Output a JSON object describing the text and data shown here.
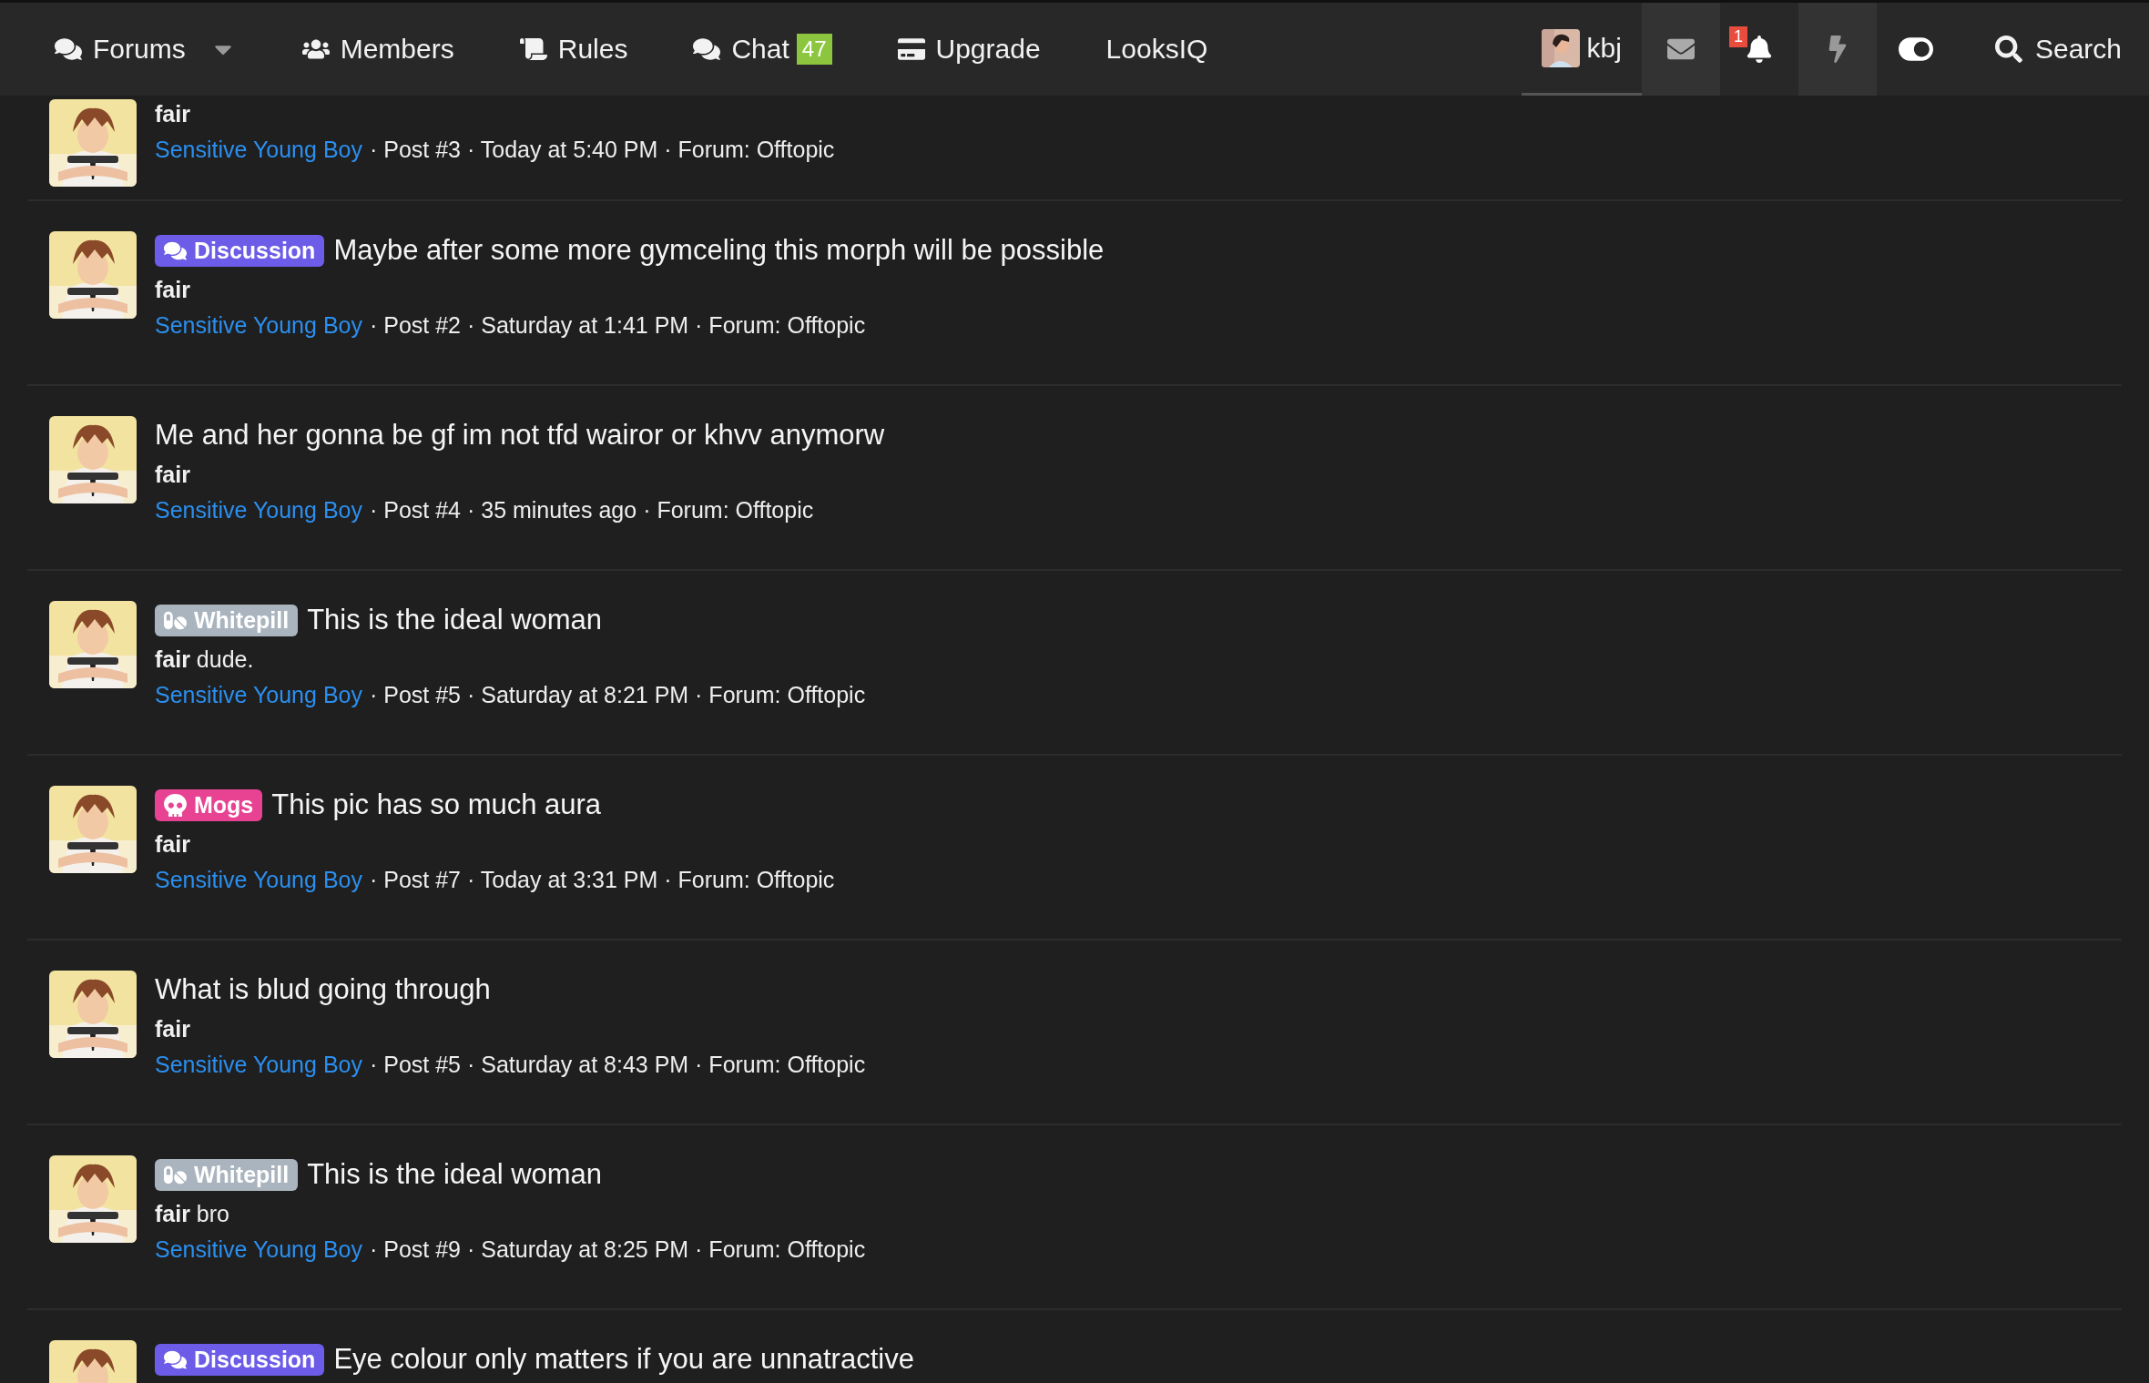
{
  "nav": {
    "items": [
      {
        "label": "Forums"
      },
      {
        "label": "Members"
      },
      {
        "label": "Rules"
      },
      {
        "label": "Chat",
        "badge": "47"
      },
      {
        "label": "Upgrade"
      },
      {
        "label": "LooksIQ"
      }
    ],
    "user": {
      "name": "kbj",
      "selected": true
    },
    "notification_count": "1",
    "search": {
      "label": "Search"
    }
  },
  "posts": [
    {
      "body": "fair",
      "body_bold": true,
      "author": "Sensitive Young Boy",
      "meta": "· Post #3 · Today at 5:40 PM · Forum: Offtopic"
    },
    {
      "prefix": {
        "label": "Discussion",
        "kind": "discussion",
        "color": "#6c5ce7"
      },
      "title": "Maybe after some more gymceling this morph will be possible",
      "body": "fair",
      "body_bold": true,
      "author": "Sensitive Young Boy",
      "meta": "· Post #2 · Saturday at 1:41 PM · Forum: Offtopic"
    },
    {
      "title": "Me and her gonna be gf im not tfd wairor or khvv anymorw",
      "body": "fair",
      "body_bold": true,
      "author": "Sensitive Young Boy",
      "meta": "· Post #4 · 35 minutes ago · Forum: Offtopic"
    },
    {
      "prefix": {
        "label": "Whitepill",
        "kind": "whitepill",
        "color": "#aab4be"
      },
      "title": "This is the ideal woman",
      "body": "**fair** dude.",
      "body_bold": false,
      "author": "Sensitive Young Boy",
      "meta": "· Post #5 · Saturday at 8:21 PM · Forum: Offtopic"
    },
    {
      "prefix": {
        "label": "Mogs",
        "kind": "mogs",
        "color": "#e84393"
      },
      "title": "This pic has so much aura",
      "body": "fair",
      "body_bold": true,
      "author": "Sensitive Young Boy",
      "meta": "· Post #7 · Today at 3:31 PM · Forum: Offtopic"
    },
    {
      "title": "What is blud going through",
      "body": "fair",
      "body_bold": true,
      "author": "Sensitive Young Boy",
      "meta": "· Post #5 · Saturday at 8:43 PM · Forum: Offtopic"
    },
    {
      "prefix": {
        "label": "Whitepill",
        "kind": "whitepill",
        "color": "#aab4be"
      },
      "title": "This is the ideal woman",
      "body": "**fair** bro",
      "body_bold": false,
      "author": "Sensitive Young Boy",
      "meta": "· Post #9 · Saturday at 8:25 PM · Forum: Offtopic"
    },
    {
      "prefix": {
        "label": "Discussion",
        "kind": "discussion",
        "color": "#6c5ce7"
      },
      "title": "Eye colour only matters if you are unnatractive"
    }
  ]
}
